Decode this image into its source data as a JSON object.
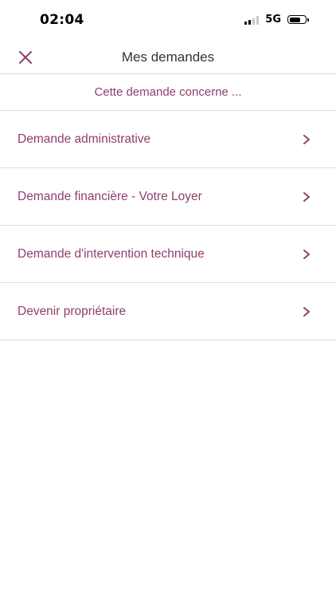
{
  "status_bar": {
    "time": "02:04",
    "network": "5G",
    "signal_bars_active": 2,
    "signal_bars_total": 4,
    "battery_level": 0.7
  },
  "header": {
    "close_icon": "close-icon",
    "title": "Mes demandes"
  },
  "subheader": {
    "text": "Cette demande concerne ..."
  },
  "menu": {
    "items": [
      {
        "label": "Demande administrative",
        "icon": "chevron-right-icon"
      },
      {
        "label": "Demande financière - Votre Loyer",
        "icon": "chevron-right-icon"
      },
      {
        "label": "Demande d'intervention technique",
        "icon": "chevron-right-icon"
      },
      {
        "label": "Devenir propriétaire",
        "icon": "chevron-right-icon"
      }
    ]
  },
  "colors": {
    "accent": "#8e3f6c",
    "divider": "#dedede",
    "title": "#333333",
    "signal_active": "#000000",
    "signal_inactive": "#c8c8c8"
  }
}
